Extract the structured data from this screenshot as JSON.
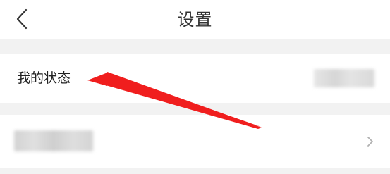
{
  "header": {
    "title": "设置",
    "back_icon": "chevron-left-icon"
  },
  "settings": {
    "rows": [
      {
        "label": "我的状态",
        "value_obscured": true
      },
      {
        "label_obscured": true,
        "chevron_icon": "chevron-right-icon"
      }
    ]
  },
  "annotation": {
    "arrow_color": "#f01e1e"
  }
}
